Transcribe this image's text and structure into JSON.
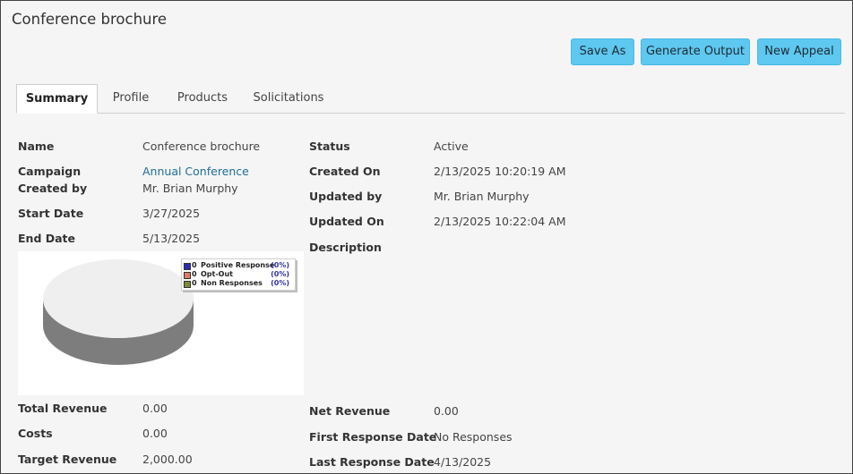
{
  "page": {
    "title": "Conference brochure"
  },
  "toolbar": {
    "save_as": "Save As",
    "generate_output": "Generate Output",
    "new_appeal": "New Appeal"
  },
  "tabs": [
    "Summary",
    "Profile",
    "Products",
    "Solicitations"
  ],
  "details_left": {
    "name_label": "Name",
    "name_value": "Conference brochure",
    "campaign_label": "Campaign",
    "campaign_value": "Annual Conference",
    "created_by_label": "Created by",
    "created_by_value": "Mr. Brian Murphy",
    "start_date_label": "Start Date",
    "start_date_value": "3/27/2025",
    "end_date_label": "End Date",
    "end_date_value": "5/13/2025"
  },
  "details_right": {
    "status_label": "Status",
    "status_value": "Active",
    "created_on_label": "Created On",
    "created_on_value": "2/13/2025 10:20:19 AM",
    "updated_by_label": "Updated by",
    "updated_by_value": "Mr. Brian Murphy",
    "updated_on_label": "Updated On",
    "updated_on_value": "2/13/2025 10:22:04 AM",
    "description_label": "Description"
  },
  "chart_data": {
    "type": "pie",
    "categories": [
      "Positive Response",
      "Opt-Out",
      "Non Responses"
    ],
    "values": [
      0,
      0,
      0
    ],
    "percent_labels": [
      "(0%)",
      "(0%)",
      "(0%)"
    ],
    "colors": [
      "#2b2bb0",
      "#e07a6a",
      "#7c8a3a"
    ],
    "legend_position": "top-right",
    "pie_face_color": "#efefef",
    "pie_side_color": "#7d7d7d"
  },
  "financials_left": {
    "total_revenue_label": "Total Revenue",
    "total_revenue_value": "0.00",
    "costs_label": "Costs",
    "costs_value": "0.00",
    "target_revenue_label": "Target Revenue",
    "target_revenue_value": "2,000.00"
  },
  "financials_right": {
    "net_revenue_label": "Net Revenue",
    "net_revenue_value": "0.00",
    "first_response_label": "First Response Date",
    "first_response_value": "No Responses",
    "last_response_label": "Last Response Date",
    "last_response_value": "4/13/2025"
  }
}
